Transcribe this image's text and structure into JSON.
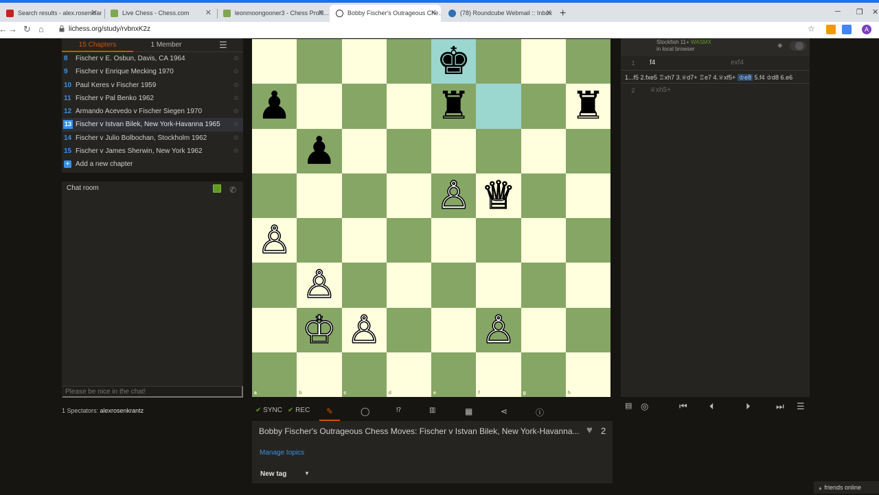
{
  "browser": {
    "tabs": [
      {
        "label": "Search results - alex.rosenkrantz...",
        "active": false
      },
      {
        "label": "Live Chess - Chess.com",
        "active": false
      },
      {
        "label": "leonmoongooner3 - Chess Profil...",
        "active": false
      },
      {
        "label": "Bobby Fischer's Outrageous Che...",
        "active": true
      },
      {
        "label": "(78) Roundcube Webmail :: Inbox",
        "active": false
      }
    ],
    "url": "lichess.org/study/rvbnxK2z",
    "new_tab_label": "+",
    "profile_initial": "A"
  },
  "study": {
    "tab_chapters": "15 Chapters",
    "tab_members": "1 Member",
    "chapters": [
      {
        "num": "8",
        "name": "Fischer v E. Osbun, Davis, CA 1964"
      },
      {
        "num": "9",
        "name": "Fischer v Enrique Mecking 1970"
      },
      {
        "num": "10",
        "name": "Paul Keres v Fischer 1959"
      },
      {
        "num": "11",
        "name": "Fischer v Pal Benko 1962"
      },
      {
        "num": "12",
        "name": "Armando Acevedo v Fischer Siegen 1970"
      },
      {
        "num": "13",
        "name": "Fischer v Istvan Bilek, New York-Havanna 1965",
        "active": true
      },
      {
        "num": "14",
        "name": "Fischer v Julio Bolbochan, Stockholm 1962"
      },
      {
        "num": "15",
        "name": "Fischer v James Sherwin, New York 1962"
      }
    ],
    "add_chapter": "Add a new chapter"
  },
  "chat": {
    "title": "Chat room",
    "placeholder": "Please be nice in the chat!"
  },
  "spectators": {
    "label": "1 Spectators:",
    "names": "alexrosenkrantz"
  },
  "board": {
    "ranks": [
      "8",
      "7",
      "6",
      "5",
      "4",
      "3",
      "2",
      "1"
    ],
    "files": [
      "a",
      "b",
      "c",
      "d",
      "e",
      "f",
      "g",
      "h"
    ],
    "highlights": [
      "e8",
      "f7"
    ],
    "pieces": [
      {
        "sq": "e8",
        "glyph": "♚",
        "color": "black"
      },
      {
        "sq": "a7",
        "glyph": "♟",
        "color": "black"
      },
      {
        "sq": "e7",
        "glyph": "♜",
        "color": "black"
      },
      {
        "sq": "h7",
        "glyph": "♜",
        "color": "black"
      },
      {
        "sq": "b6",
        "glyph": "♟",
        "color": "black"
      },
      {
        "sq": "e5",
        "glyph": "♙",
        "color": "white"
      },
      {
        "sq": "f5",
        "glyph": "♕",
        "color": "white"
      },
      {
        "sq": "a4",
        "glyph": "♙",
        "color": "white"
      },
      {
        "sq": "b3",
        "glyph": "♙",
        "color": "white"
      },
      {
        "sq": "b2",
        "glyph": "♔",
        "color": "white"
      },
      {
        "sq": "c2",
        "glyph": "♙",
        "color": "white"
      },
      {
        "sq": "f2",
        "glyph": "♙",
        "color": "white"
      }
    ]
  },
  "tools": {
    "sync": "SYNC",
    "rec": "REC"
  },
  "chapter_info": {
    "title": "Bobby Fischer's Outrageous Chess Moves: Fischer v Istvan Bilek, New York-Havanna...",
    "likes": "2",
    "manage_topics": "Manage topics",
    "new_tag": "New tag"
  },
  "engine": {
    "name": "Stockfish 11+",
    "variant": "WASMX",
    "location": "in local browser"
  },
  "moves": {
    "row1": {
      "idx": "1",
      "white": "f4",
      "black": "exf4"
    },
    "pv_before": "1...f5 2.fxe5 ♖xh7 3.♕d7+ ♖e7 4.♕xf5+ ",
    "pv_highlight": "♔e8",
    "pv_after": " 5.f4 ♔d8 6.e6",
    "row2": {
      "idx": "2",
      "white": "♕xh5+"
    }
  },
  "footer": {
    "friends": "friends online"
  },
  "colors": {
    "accent": "#d64f00",
    "link": "#3692e7",
    "board_light": "#ffffdd",
    "board_dark": "#86a666",
    "highlight": "#9bd6cf"
  }
}
